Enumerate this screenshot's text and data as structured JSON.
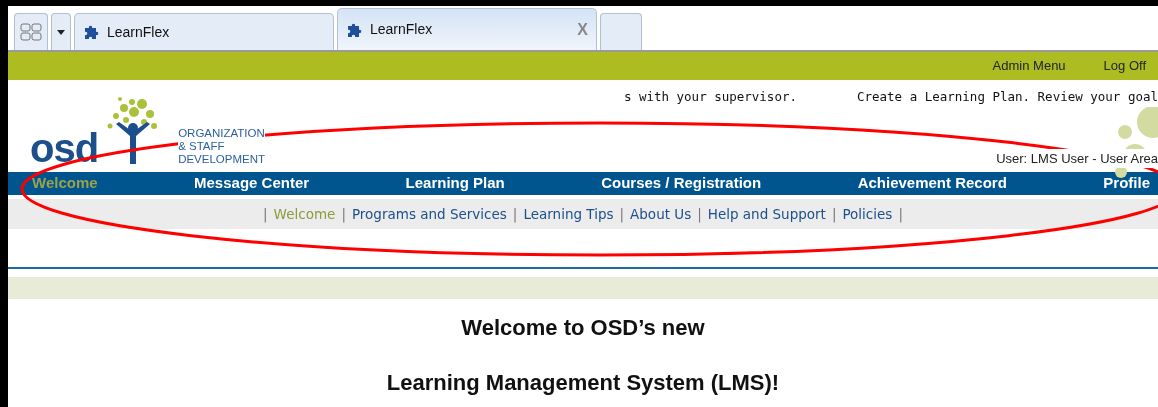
{
  "browser_tabs": [
    {
      "label": "LearnFlex",
      "selected": false
    },
    {
      "label": "LearnFlex",
      "selected": true,
      "close": "X"
    }
  ],
  "top_bar": {
    "links": [
      "Admin Menu",
      "Log Off"
    ]
  },
  "header": {
    "logo_text": "osd",
    "org_lines": [
      "ORGANIZATION",
      "& STAFF",
      "DEVELOPMENT"
    ],
    "ticker": [
      "s with your supervisor.",
      "Create a Learning Plan. Review your goal"
    ],
    "user_info": "User: LMS User - User Area"
  },
  "main_nav": [
    {
      "label": "Welcome",
      "selected": true
    },
    {
      "label": "Message Center",
      "selected": false
    },
    {
      "label": "Learning Plan",
      "selected": false
    },
    {
      "label": "Courses / Registration",
      "selected": false
    },
    {
      "label": "Achievement Record",
      "selected": false
    },
    {
      "label": "Profile",
      "selected": false
    }
  ],
  "sub_nav": [
    {
      "kind": "separator",
      "label": "|"
    },
    {
      "kind": "link",
      "label": "Welcome",
      "selected": true
    },
    {
      "kind": "separator",
      "label": "|"
    },
    {
      "kind": "link",
      "label": "Programs and Services",
      "selected": false
    },
    {
      "kind": "separator",
      "label": "|"
    },
    {
      "kind": "link",
      "label": "Learning Tips",
      "selected": false
    },
    {
      "kind": "separator",
      "label": "|"
    },
    {
      "kind": "link",
      "label": "About Us",
      "selected": false
    },
    {
      "kind": "separator",
      "label": "|"
    },
    {
      "kind": "link",
      "label": "Help and Support",
      "selected": false
    },
    {
      "kind": "separator",
      "label": "|"
    },
    {
      "kind": "link",
      "label": "Policies",
      "selected": false
    },
    {
      "kind": "separator",
      "label": "|"
    }
  ],
  "content": {
    "headings": [
      "Welcome to OSD’s new",
      "Learning Management System (LMS)!"
    ]
  },
  "annotation": {
    "kind": "ellipse",
    "color": "#ff0000"
  }
}
